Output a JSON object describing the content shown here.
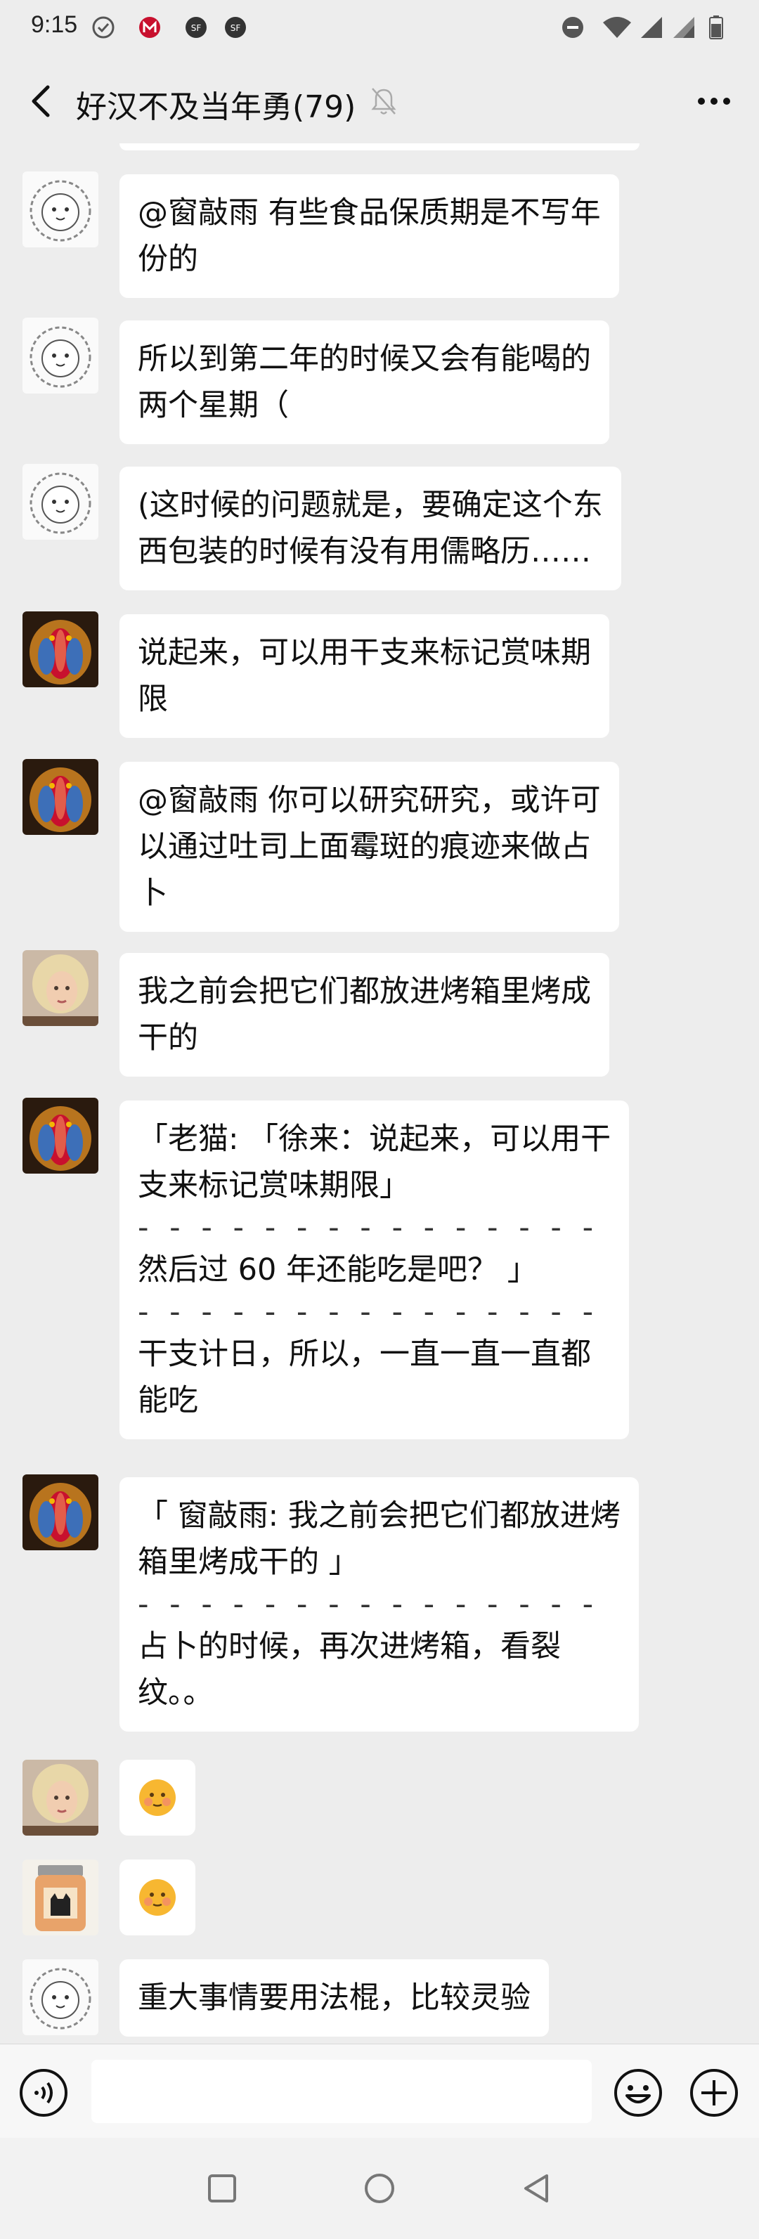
{
  "status": {
    "time": "9:15"
  },
  "header": {
    "title": "好汉不及当年勇(79)"
  },
  "messages": [
    {
      "avatar": "lion-sketch-avatar",
      "lines": [
        "@窗敲雨 有些食品保质期是不写年",
        "份的"
      ]
    },
    {
      "avatar": "lion-sketch-avatar",
      "lines": [
        "所以到第二年的时候又会有能喝的",
        "两个星期（"
      ]
    },
    {
      "avatar": "lion-sketch-avatar",
      "lines": [
        "(这时候的问题就是，要确定这个东",
        "西包装的时候有没有用儒略历……"
      ]
    },
    {
      "avatar": "mandrill-avatar",
      "lines": [
        "说起来，可以用干支来标记赏味期",
        "限"
      ]
    },
    {
      "avatar": "mandrill-avatar",
      "lines": [
        "@窗敲雨 你可以研究研究，或许可",
        "以通过吐司上面霉斑的痕迹来做占",
        "卜"
      ]
    },
    {
      "avatar": "blonde-woman-avatar",
      "lines": [
        "我之前会把它们都放进烤箱里烤成",
        "干的"
      ]
    },
    {
      "avatar": "mandrill-avatar",
      "lines": [
        "「老猫: 「徐来：说起来，可以用干",
        "支来标记赏味期限」",
        "- - - - - - - - - - - - - - -",
        "然后过 60 年还能吃是吧？ 」",
        "- - - - - - - - - - - - - - -",
        "干支计日，所以，一直一直一直都",
        "能吃"
      ]
    },
    {
      "avatar": "mandrill-avatar",
      "lines": [
        "「 窗敲雨: 我之前会把它们都放进烤",
        "箱里烤成干的 」",
        "- - - - - - - - - - - - - - -",
        "占卜的时候，再次进烤箱，看裂",
        "纹。。"
      ]
    },
    {
      "avatar": "blonde-woman-avatar",
      "emoji": "flushed-smile-emoji"
    },
    {
      "avatar": "cat-jar-avatar",
      "emoji": "flushed-smile-emoji"
    },
    {
      "avatar": "lion-sketch-avatar",
      "lines": [
        "重大事情要用法棍，比较灵验"
      ]
    }
  ],
  "colors": {
    "background": "#ededed",
    "bubble": "#ffffff",
    "emoji": "#f7b731"
  },
  "icons": [
    "check-circle-icon",
    "metro-icon",
    "sf-express-icon",
    "dnd-icon",
    "wifi-icon",
    "signal-icon",
    "battery-icon",
    "back-icon",
    "mute-icon",
    "more-icon",
    "voice-icon",
    "emoji-icon",
    "plus-icon",
    "nav-recents-icon",
    "nav-home-icon",
    "nav-back-icon"
  ]
}
